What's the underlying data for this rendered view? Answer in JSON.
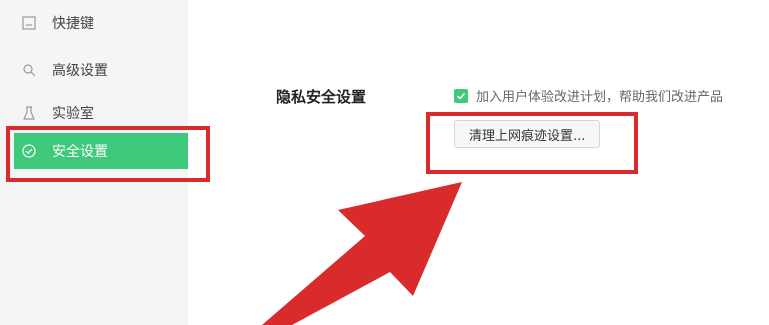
{
  "sidebar": {
    "items": [
      {
        "label": "快捷键",
        "icon": "keyboard-icon",
        "active": false
      },
      {
        "label": "高级设置",
        "icon": "search-gear-icon",
        "active": false
      },
      {
        "label": "实验室",
        "icon": "flask-icon",
        "active": false
      },
      {
        "label": "安全设置",
        "icon": "check-circle-icon",
        "active": true
      }
    ]
  },
  "privacy": {
    "section_title": "隐私安全设置",
    "checkbox_label": "加入用户体验改进计划，帮助我们改进产品",
    "checkbox_checked": true,
    "clear_button_label": "清理上网痕迹设置..."
  },
  "colors": {
    "accent": "#3fc97a",
    "annotation": "#d92b2b"
  }
}
